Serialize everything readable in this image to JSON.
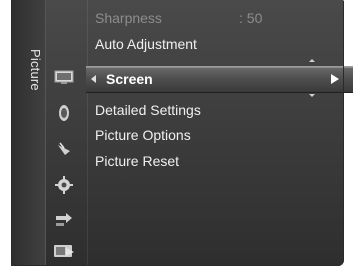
{
  "sidebar": {
    "label": "Picture",
    "icons": [
      "picture-icon",
      "sound-icon",
      "channel-icon",
      "setup-icon",
      "input-icon",
      "application-icon"
    ]
  },
  "menu": {
    "items": [
      {
        "label": "Sharpness",
        "value": ": 50",
        "state": "dim"
      },
      {
        "label": "Auto Adjustment",
        "state": "normal"
      },
      {
        "label": "Screen",
        "state": "selected"
      },
      {
        "label": "Detailed Settings",
        "state": "normal"
      },
      {
        "label": "Picture Options",
        "state": "normal"
      },
      {
        "label": "Picture Reset",
        "state": "normal"
      }
    ]
  },
  "colors": {
    "panel": "#3c3c3c",
    "selection": "#5a5a5a",
    "text": "#f0f0f0",
    "dim_text": "#8d8d8d"
  }
}
